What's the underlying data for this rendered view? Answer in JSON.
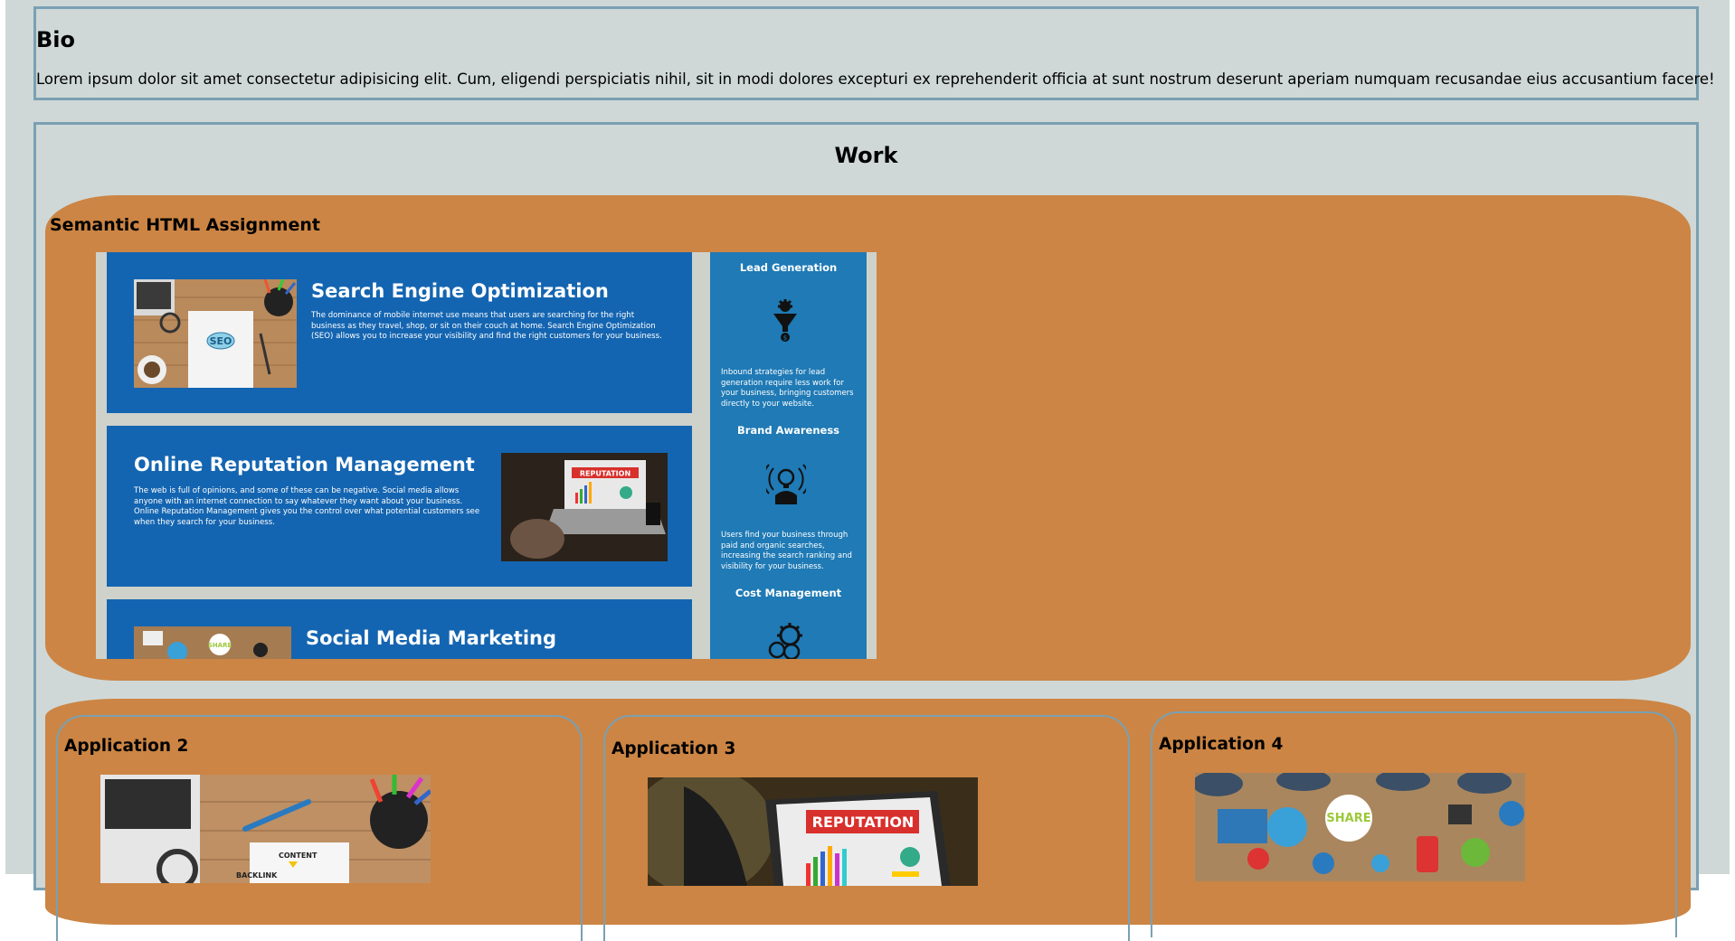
{
  "bio": {
    "heading": "Bio",
    "text": "Lorem ipsum dolor sit amet consectetur adipisicing elit. Cum, eligendi perspiciatis nihil, sit in modi dolores excepturi ex reprehenderit officia at sunt nostrum deserunt aperiam numquam recusandae eius accusantium facere!"
  },
  "work": {
    "heading": "Work",
    "main_project": {
      "title": "Semantic HTML Assignment",
      "cards": [
        {
          "title": "Search Engine Optimization",
          "text": "The dominance of mobile internet use means that users are searching for the right business as they travel, shop, or sit on their couch at home. Search Engine Optimization (SEO) allows you to increase your visibility and find the right customers for your business.",
          "image_label": "SEO"
        },
        {
          "title": "Online Reputation Management",
          "text": "The web is full of opinions, and some of these can be negative. Social media allows anyone with an internet connection to say whatever they want about your business. Online Reputation Management gives you the control over what potential customers see when they search for your business.",
          "image_label": "REPUTATION"
        },
        {
          "title": "Social Media Marketing",
          "image_label": "SHARE"
        }
      ],
      "sidebar": [
        {
          "title": "Lead Generation",
          "text": "Inbound strategies for lead generation require less work for your business, bringing customers directly to your website.",
          "icon": "funnel-gear-icon"
        },
        {
          "title": "Brand Awareness",
          "text": "Users find your business through paid and organic searches, increasing the search ranking and visibility for your business.",
          "icon": "lightbulb-head-icon"
        },
        {
          "title": "Cost Management",
          "icon": "gear-coins-icon"
        }
      ]
    },
    "applications": [
      {
        "title": "Application 2",
        "image_labels": [
          "CONTENT",
          "BACKLINK"
        ]
      },
      {
        "title": "Application 3",
        "image_label": "REPUTATION"
      },
      {
        "title": "Application 4",
        "image_label": "SHARE"
      }
    ]
  },
  "colors": {
    "page_bg": "#cfd8d7",
    "section_border": "#7aa0b3",
    "project_bg": "#cc8544",
    "card_blue": "#1465b1",
    "sidebar_blue": "#1f7ab5"
  }
}
